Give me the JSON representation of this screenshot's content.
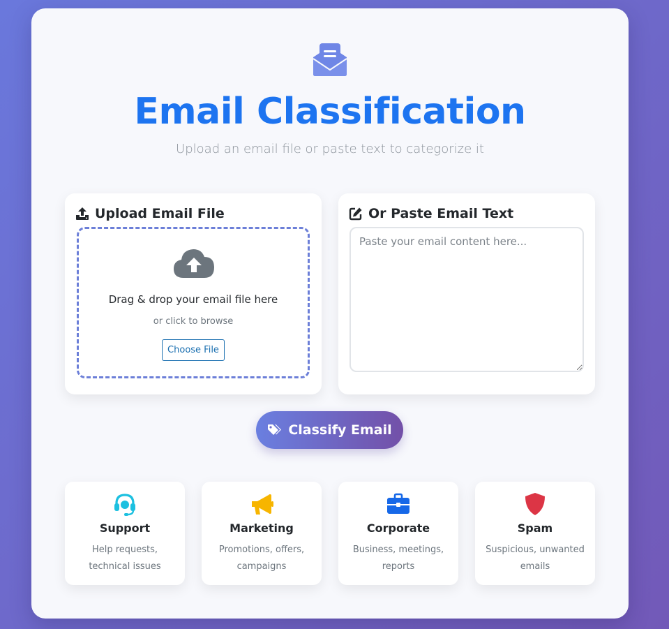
{
  "header": {
    "icon": "envelope-open-text-icon",
    "title": "Email Classification",
    "subtitle": "Upload an email file or paste text to categorize it"
  },
  "upload": {
    "icon": "upload-icon",
    "heading": "Upload Email File",
    "cloud_icon": "cloud-upload-icon",
    "drop_text": "Drag & drop your email file here",
    "browse_text": "or click to browse",
    "choose_button": "Choose File"
  },
  "paste": {
    "icon": "edit-icon",
    "heading": "Or Paste Email Text",
    "placeholder": "Paste your email content here...",
    "value": ""
  },
  "classify_button": {
    "icon": "tags-icon",
    "label": "Classify Email"
  },
  "categories": [
    {
      "name": "Support",
      "description": "Help requests, technical issues",
      "icon": "headset-icon",
      "color": "#1cc0e0"
    },
    {
      "name": "Marketing",
      "description": "Promotions, offers, campaigns",
      "icon": "bullhorn-icon",
      "color": "#f7b500"
    },
    {
      "name": "Corporate",
      "description": "Business, meetings, reports",
      "icon": "briefcase-icon",
      "color": "#1668e8"
    },
    {
      "name": "Spam",
      "description": "Suspicious, unwanted emails",
      "icon": "shield-icon",
      "color": "#dc3545"
    }
  ],
  "colors": {
    "title": "#1d74f0",
    "accent": "#6c7fd8",
    "background_start": "#6a78dc",
    "background_end": "#7259b8"
  }
}
